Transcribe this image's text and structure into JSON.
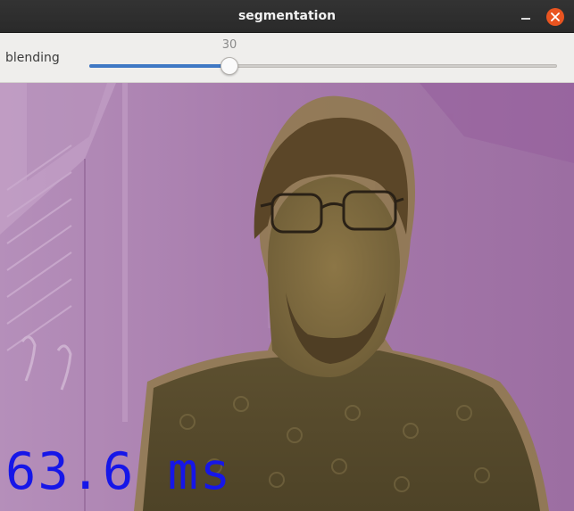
{
  "window": {
    "title": "segmentation"
  },
  "toolbar": {
    "trackbar": {
      "label": "blending",
      "value": "30",
      "level_fraction": 0.3
    }
  },
  "view": {
    "overlay_text": "63.6 ms",
    "overlay_color": "#1616e8",
    "background_mask_color": "#a173a8",
    "person_tint_color": "#6b5a32"
  },
  "colors": {
    "titlebar": "#2f2f2f",
    "close_button": "#e95420",
    "slider_fill": "#3f78c4"
  },
  "icons": {
    "minimize": "minimize-icon",
    "close": "close-icon"
  }
}
